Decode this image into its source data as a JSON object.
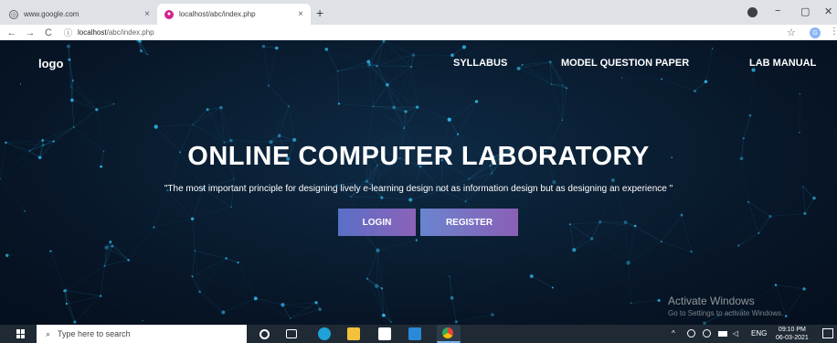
{
  "browser": {
    "tabs": [
      {
        "title": "www.google.com",
        "active": false
      },
      {
        "title": "localhost/abc/index.php",
        "active": true
      }
    ],
    "new_tab_label": "+",
    "tab_close_glyph": "×",
    "address": {
      "host": "localhost",
      "path": "/abc/index.php"
    },
    "profile_initial": "G",
    "nav_glyphs": {
      "back": "←",
      "forward": "→",
      "reload": "C",
      "info": "ⓘ",
      "star": "☆",
      "menu": "⋮"
    },
    "window_controls": {
      "minimize": "−",
      "maximize": "▢",
      "close": "✕"
    }
  },
  "site": {
    "logo": "logo",
    "nav": [
      "SYLLABUS",
      "MODEL QUESTION PAPER",
      "LAB MANUAL"
    ],
    "title": "ONLINE COMPUTER LABORATORY",
    "quote": "\"The most important principle for designing lively e-learning design not as information design but as designing an experience \"",
    "buttons": {
      "login": "LOGIN",
      "register": "REGISTER"
    },
    "watermark": {
      "title": "Activate Windows",
      "subtitle": "Go to Settings to activate Windows."
    }
  },
  "taskbar": {
    "search_placeholder": "Type here to search",
    "search_glyph": "⌕",
    "tray_language": "ENG",
    "tray_chevron": "^",
    "time": "09:10 PM",
    "date": "06-03-2021"
  },
  "colors": {
    "page_bg": "#0a1b2e",
    "network": "#2fb0e0",
    "login_gradient": [
      "#5a6fc7",
      "#8b62b8"
    ],
    "register_gradient": [
      "#6a84cf",
      "#8a5fb5"
    ],
    "taskbar_bg": "#1f2a35"
  },
  "icons": {
    "taskbar_apps": [
      "cortana-icon",
      "task-view-icon",
      "edge-icon",
      "file-explorer-icon",
      "store-icon",
      "mail-icon",
      "chrome-icon"
    ],
    "tray": [
      "network-icon",
      "volume-icon",
      "battery-icon"
    ]
  }
}
